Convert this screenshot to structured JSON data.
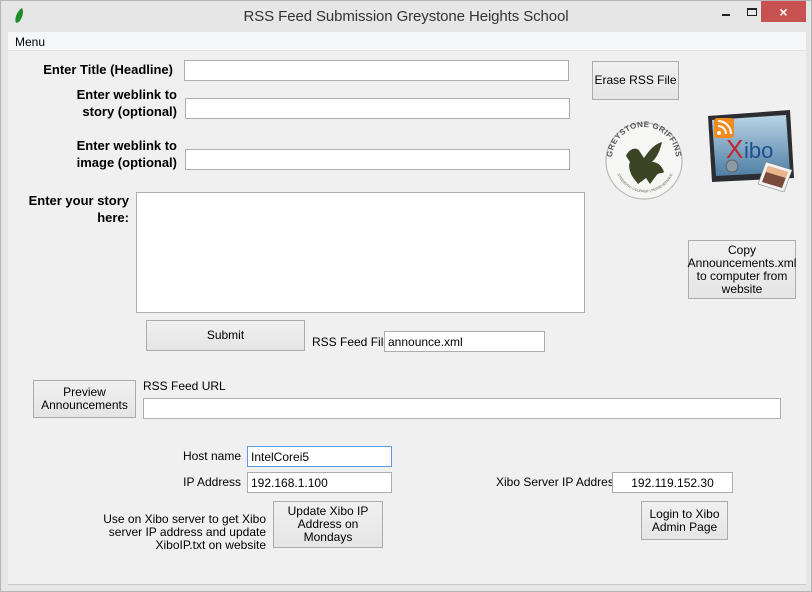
{
  "window": {
    "title": "RSS Feed Submission Greystone Heights School",
    "icon": "leaf-icon",
    "controls": {
      "minimize": "minimize-icon",
      "maximize": "maximize-icon",
      "close": "×"
    }
  },
  "menubar": {
    "items": [
      {
        "label": "Menu"
      }
    ]
  },
  "form": {
    "title_label": "Enter Title (Headline)",
    "title_value": "",
    "story_link_label_1": "Enter weblink to",
    "story_link_label_2": "story (optional)",
    "story_link_value": "",
    "image_link_label_1": "Enter weblink to",
    "image_link_label_2": "image (optional)",
    "image_link_value": "",
    "story_label_1": "Enter your story",
    "story_label_2": "here:",
    "story_value": "",
    "submit_label": "Submit",
    "rss_file_label": "RSS Feed File",
    "rss_file_value": "announce.xml",
    "rss_url_label": "RSS Feed URL",
    "rss_url_value": ""
  },
  "buttons": {
    "erase_rss": "Erase RSS File",
    "copy_announcements": "Copy\nAnnouncements.xml\nto computer from\nwebsite",
    "preview": "Preview\nAnnouncements",
    "update_xibo_ip": "Update Xibo IP\nAddress on Mondays",
    "login_xibo": "Login to Xibo\nAdmin Page"
  },
  "logos": {
    "griffins": {
      "top_text": "GREYSTONE GRIFFINS",
      "bottom_text": "STRENGTH | COURAGE | PERSEVERANCE",
      "color": "#3b4424"
    },
    "xibo": {
      "text": "Xibo",
      "rss_color": "#f28a1e",
      "x_color": "#c0262c",
      "ibo_color": "#1d4e8f"
    }
  },
  "network": {
    "host_label": "Host name",
    "host_value": "IntelCorei5",
    "ip_label": "IP Address",
    "ip_value": "192.168.1.100",
    "xibo_server_label": "Xibo Server IP Address",
    "xibo_server_value": "192.119.152.30",
    "help_text_1": "Use on Xibo server to get Xibo",
    "help_text_2": "server IP address and update",
    "help_text_3": "XiboIP.txt on website"
  }
}
